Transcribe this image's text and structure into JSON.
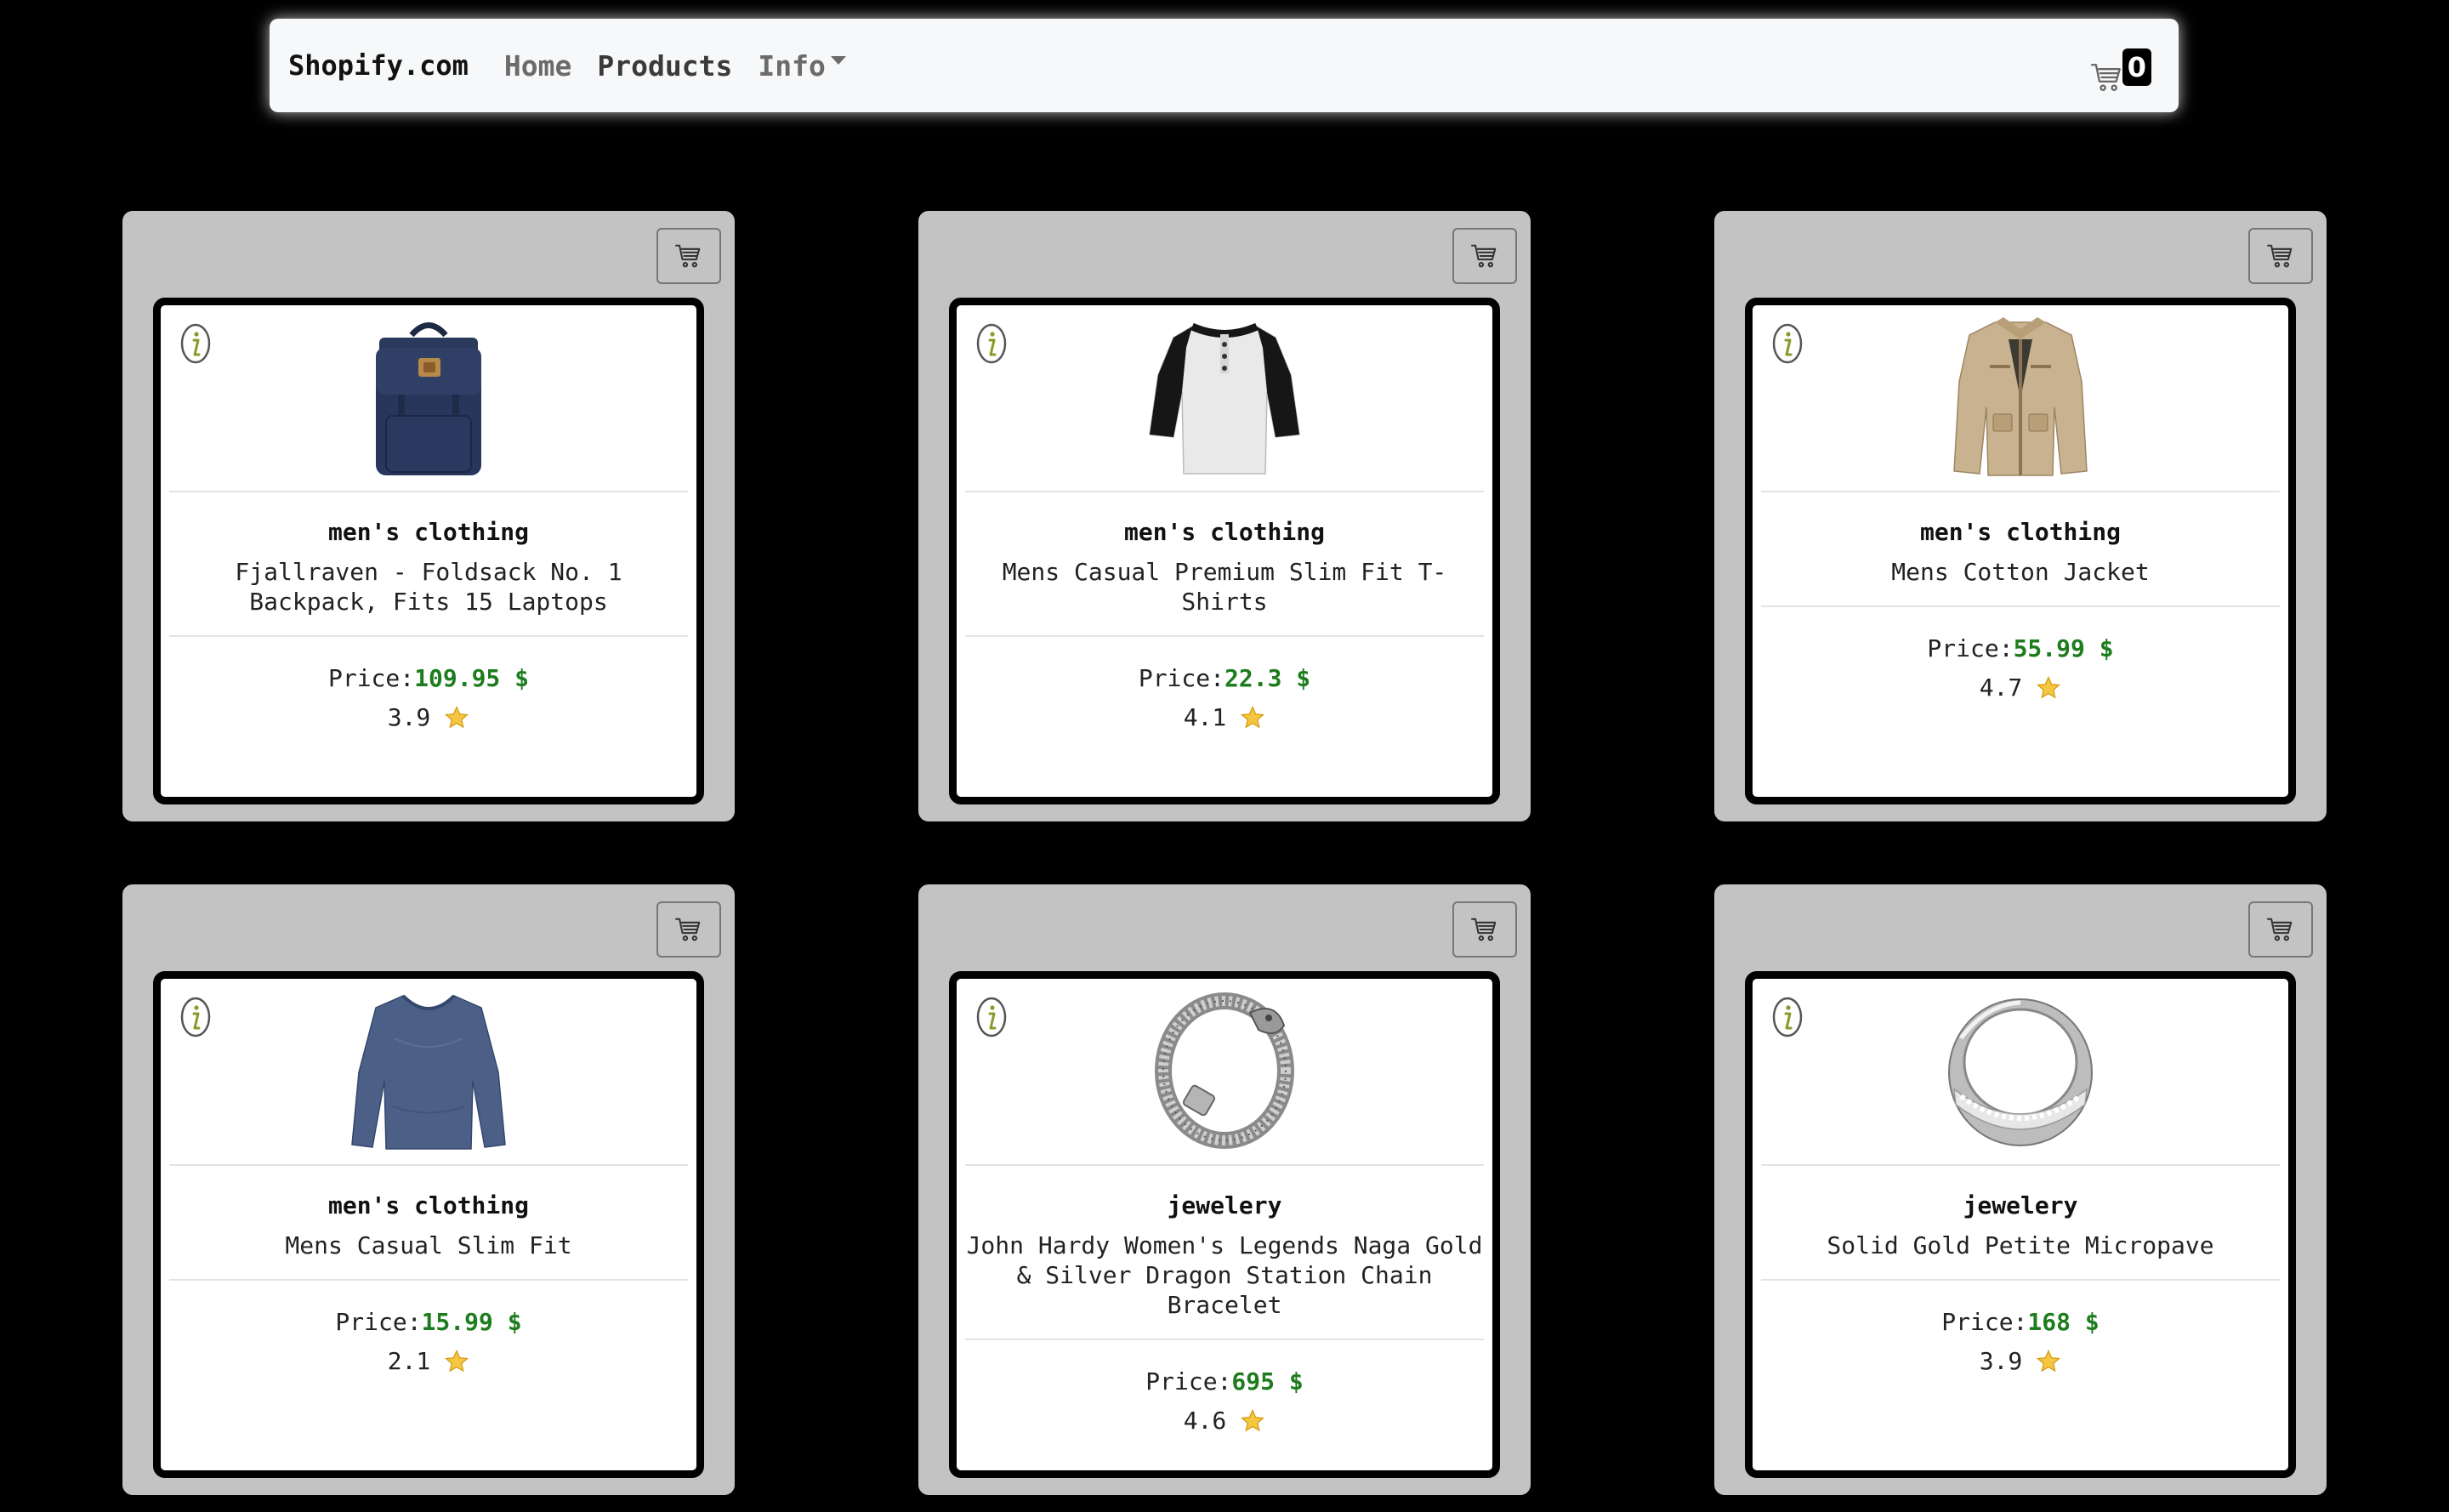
{
  "navbar": {
    "brand": "Shopify.com",
    "links": [
      "Home",
      "Products",
      "Info"
    ],
    "cart_count": "0"
  },
  "colors": {
    "background": "#000000",
    "card": "#c3c3c3",
    "price": "#1d7c1d",
    "navbar": "#f7f8f9"
  },
  "price_label": "Price:",
  "currency": "$",
  "products": [
    {
      "category": "men's clothing",
      "title": "Fjallraven - Foldsack No. 1 Backpack, Fits 15 Laptops",
      "price": "109.95",
      "rating": "3.9",
      "image": "backpack"
    },
    {
      "category": "men's clothing",
      "title": "Mens Casual Premium Slim Fit T-Shirts",
      "price": "22.3",
      "rating": "4.1",
      "image": "henley-shirt"
    },
    {
      "category": "men's clothing",
      "title": "Mens Cotton Jacket",
      "price": "55.99",
      "rating": "4.7",
      "image": "jacket"
    },
    {
      "category": "men's clothing",
      "title": "Mens Casual Slim Fit",
      "price": "15.99",
      "rating": "2.1",
      "image": "long-sleeve-shirt"
    },
    {
      "category": "jewelery",
      "title": "John Hardy Women's Legends Naga Gold & Silver Dragon Station Chain Bracelet",
      "price": "695",
      "rating": "4.6",
      "image": "dragon-bracelet"
    },
    {
      "category": "jewelery",
      "title": "Solid Gold Petite Micropave",
      "price": "168",
      "rating": "3.9",
      "image": "ring"
    }
  ]
}
